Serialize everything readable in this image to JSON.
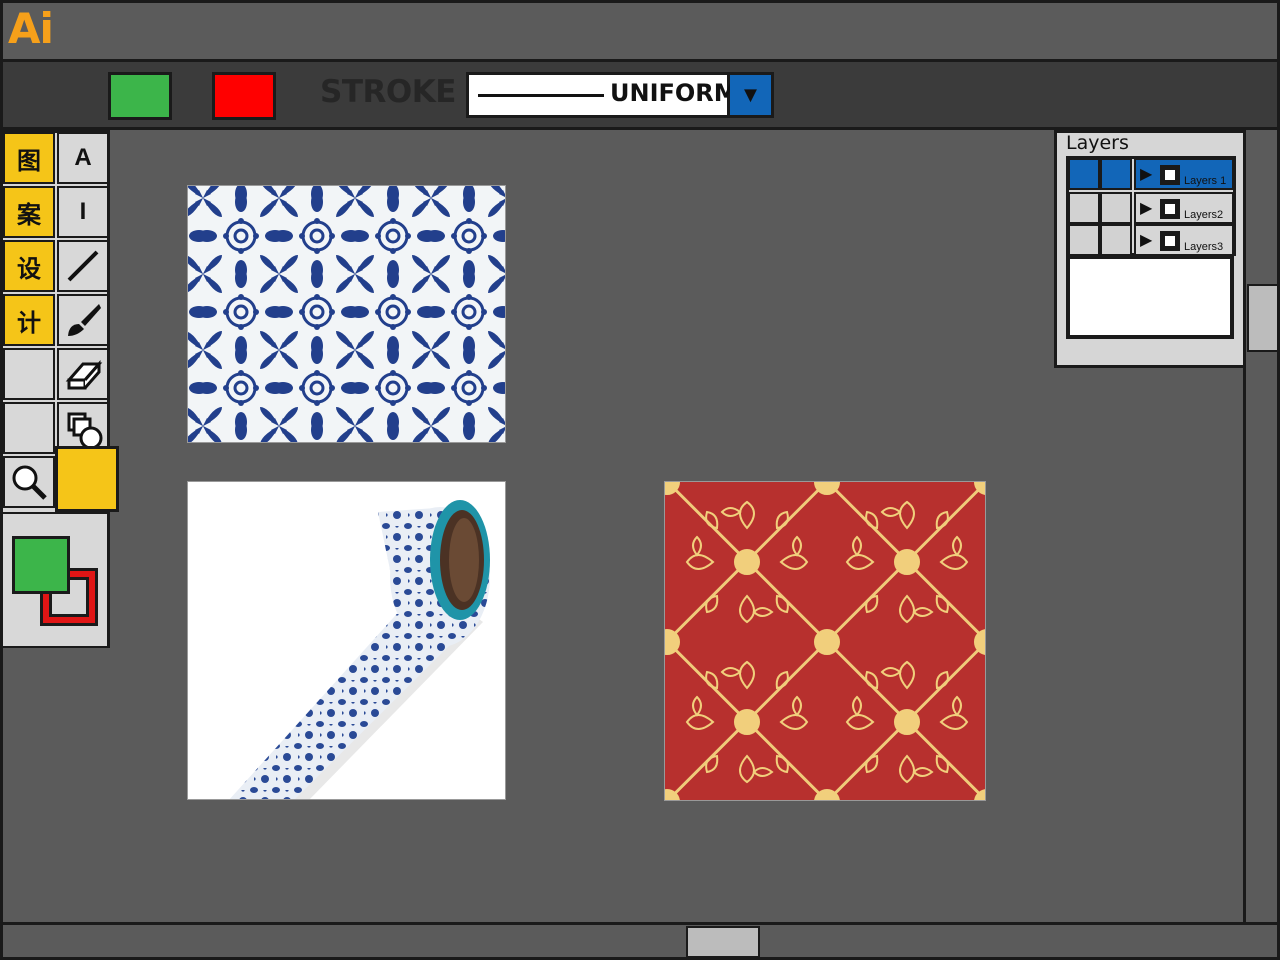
{
  "app": {
    "logo": "Ai"
  },
  "options_bar": {
    "fill_color": "#3cb54a",
    "stroke_color": "#ff0000",
    "stroke_label": "STROKE",
    "stroke_profile": "UNIFORM"
  },
  "toolbox": {
    "title_chars": [
      "图",
      "案",
      "设",
      "计"
    ],
    "type_tool_label": "A",
    "vertical_type_label": "I",
    "accent_color": "#f5c518",
    "fill_swatch": "#3cb54a",
    "stroke_swatch": "#e01515"
  },
  "layers_panel": {
    "title": "Layers",
    "layers": [
      {
        "name": "Layers 1",
        "selected": true
      },
      {
        "name": "Layers2",
        "selected": false
      },
      {
        "name": "Layers3",
        "selected": false
      }
    ],
    "selection_color": "#1266b8"
  },
  "artworks": [
    {
      "name": "blue-floral-pattern",
      "colors": [
        "#f2f5f7",
        "#223f8c"
      ]
    },
    {
      "name": "washi-tape-mockup",
      "colors": [
        "#ffffff",
        "#1f94a8",
        "#2a4a96"
      ]
    },
    {
      "name": "red-gold-pattern",
      "colors": [
        "#b7302e",
        "#f1cf7c"
      ]
    }
  ]
}
